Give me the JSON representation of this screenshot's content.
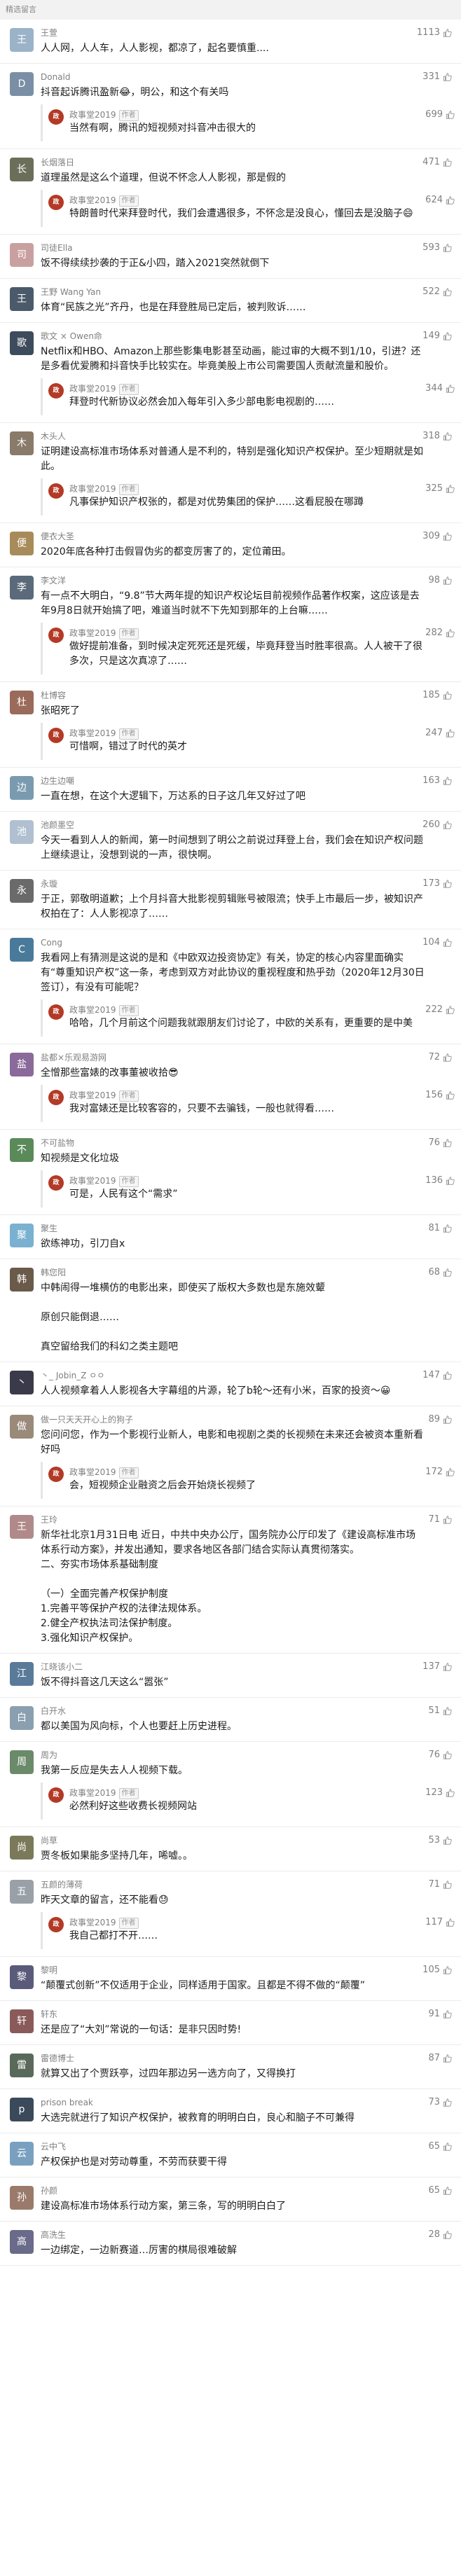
{
  "section_title": "精选留言",
  "author_name": "政事堂2019",
  "author_tag": "作者",
  "comments": [
    {
      "name": "王萱",
      "avatar_color": "#9bb3c9",
      "likes": "1113",
      "content": "人人网，人人车，人人影视，都凉了，起名要慎重....",
      "reply": null
    },
    {
      "name": "Donald",
      "avatar_color": "#7a8fa6",
      "likes": "331",
      "content": "抖音起诉腾讯盈新😂，明公，和这个有关吗",
      "reply": {
        "likes": "699",
        "content": "当然有啊，腾讯的短视频对抖音冲击很大的"
      }
    },
    {
      "name": "长烟落日",
      "avatar_color": "#6b6f5a",
      "likes": "471",
      "content": "道理虽然是这么个道理，但说不怀念人人影视，那是假的",
      "reply": {
        "likes": "624",
        "content": "特朗普时代来拜登时代，我们会遭遇很多，不怀念是没良心，懂回去是没脑子😄"
      }
    },
    {
      "name": "司徒Ella",
      "avatar_color": "#c9a0a0",
      "likes": "593",
      "content": "饭不得续续抄袭的于正&小四，踏入2021突然就倒下",
      "reply": null
    },
    {
      "name": "王野 Wang Yan",
      "avatar_color": "#4a5a6a",
      "likes": "522",
      "content": "体育“民族之光”齐丹，也是在拜登胜局已定后，被判败诉……",
      "reply": null
    },
    {
      "name": "歌文 × Owen命",
      "avatar_color": "#3d4b5c",
      "likes": "149",
      "content": "Netflix和HBO、Amazon上那些影集电影甚至动画，能过审的大概不到1/10，引进？还是多看优爱腾和抖音快手比较实在。毕竟美股上市公司需要国人贡献流量和股价。",
      "reply": {
        "likes": "344",
        "content": "拜登时代新协议必然会加入每年引入多少部电影电视剧的……"
      }
    },
    {
      "name": "木头人",
      "avatar_color": "#8a7a6a",
      "likes": "318",
      "content": "证明建设高标准市场体系对普通人是不利的，特别是强化知识产权保护。至少短期就是如此。",
      "reply": {
        "likes": "325",
        "content": "凡事保护知识产权张的，都是对优势集团的保护……这看屁股在哪蹲"
      }
    },
    {
      "name": "便衣大圣",
      "avatar_color": "#a88b5a",
      "likes": "309",
      "content": "2020年底各种打击假冒伪劣的都变厉害了的，定位莆田。",
      "reply": null
    },
    {
      "name": "李文洋",
      "avatar_color": "#5a6a7a",
      "likes": "98",
      "content": "有一点不大明白，“9.8”节大两年提的知识产权论坛目前视频作品著作权案，这应该是去年9月8日就开始搞了吧，难道当时就不下先知到那年的上台嘛……",
      "reply": {
        "likes": "282",
        "content": "做好提前准备，到时候决定死死还是死缓，毕竟拜登当时胜率很高。人人被干了很多次，只是这次真凉了……"
      }
    },
    {
      "name": "杜博容",
      "avatar_color": "#9a6a5a",
      "likes": "185",
      "content": "张昭死了",
      "reply": {
        "likes": "247",
        "content": "可惜啊，错过了时代的英才"
      }
    },
    {
      "name": "边生边嘲",
      "avatar_color": "#7a9ab0",
      "likes": "163",
      "content": "一直在想，在这个大逻辑下，万达系的日子这几年又好过了吧",
      "reply": null
    },
    {
      "name": "池颜墨空",
      "avatar_color": "#b0c0d0",
      "likes": "260",
      "content": "今天一看到人人的新闻，第一时间想到了明公之前说过拜登上台，我们会在知识产权问题上继续退让，没想到说的一声，很快啊。",
      "reply": null
    },
    {
      "name": "永璇",
      "avatar_color": "#6a6a6a",
      "likes": "173",
      "content": "于正，郭敬明道歉；上个月抖音大批影视剪辑账号被限流；快手上市最后一步，被知识产权拍在了：人人影视凉了……",
      "reply": null
    },
    {
      "name": "Cong",
      "avatar_color": "#4a7a9a",
      "likes": "104",
      "content": "我看网上有猜测是这说的是和《中欧双边投资协定》有关，协定的核心内容里面确实有“尊重知识产权”这一条，考虑到双方对此协议的重视程度和热乎劲（2020年12月30日签订），有没有可能呢？",
      "reply": {
        "likes": "222",
        "content": "哈哈，几个月前这个问题我就跟朋友们讨论了，中欧的关系有，更重要的是中美"
      }
    },
    {
      "name": "盐都×乐观易游网",
      "avatar_color": "#8a6a9a",
      "likes": "72",
      "content": "全憎那些富婊的改事董被收拾😎",
      "reply": {
        "likes": "156",
        "content": "我对富婊还是比较客容的，只要不去骗钱，一般也就得看……"
      }
    },
    {
      "name": "不可盐物",
      "avatar_color": "#5a8a5a",
      "likes": "76",
      "content": "知视频是文化垃圾",
      "reply": {
        "likes": "136",
        "content": "可是，人民有这个“需求”"
      }
    },
    {
      "name": "聚生",
      "avatar_color": "#7ab0d0",
      "likes": "81",
      "content": "欲练神功，引刀自x",
      "reply": null
    },
    {
      "name": "韩您阳",
      "avatar_color": "#6a5a4a",
      "likes": "68",
      "content": "中韩闹得一堆横仿的电影出来，即使买了版权大多数也是东施效颦\n\n原创只能倒退……\n\n真空留给我们的科幻之类主题吧",
      "reply": null
    },
    {
      "name": "丶_ Jobin_Z ㅇㅇ",
      "avatar_color": "#3a3a4a",
      "likes": "147",
      "content": "人人视频拿着人人影视各大字幕组的片源，轮了b轮～还有小米，百家的投资～😀",
      "reply": null
    },
    {
      "name": "做一只天天开心上的狗子",
      "avatar_color": "#9a8a7a",
      "likes": "89",
      "content": "您问问您，作为一个影视行业新人，电影和电视剧之类的长视频在未来还会被资本重新看好吗",
      "reply": {
        "likes": "172",
        "content": "会，短视频企业融资之后会开始烧长视频了"
      }
    },
    {
      "name": "王玲",
      "avatar_color": "#b08a8a",
      "likes": "71",
      "content": "新华社北京1月31日电 近日，中共中央办公厅，国务院办公厅印发了《建设高标准市场体系行动方案》，并发出通知，要求各地区各部门结合实际认真贯彻落实。\n二、夯实市场体系基础制度\n\n（一）全面完善产权保护制度\n1.完善平等保护产权的法律法规体系。\n2.健全产权执法司法保护制度。\n3.强化知识产权保护。",
      "reply": null
    },
    {
      "name": "江晓该小二",
      "avatar_color": "#5a7a9a",
      "likes": "137",
      "content": "饭不得抖音这几天这么“嚣张”",
      "reply": null
    },
    {
      "name": "白开水",
      "avatar_color": "#8aa0b0",
      "likes": "51",
      "content": "都以美国为风向标，个人也要赶上历史进程。",
      "reply": null
    },
    {
      "name": "周为",
      "avatar_color": "#6a8a6a",
      "likes": "76",
      "content": "我第一反应是失去人人视频下载。",
      "reply": {
        "likes": "123",
        "content": "必然利好这些收费长视频网站"
      }
    },
    {
      "name": "尚草",
      "avatar_color": "#7a7a5a",
      "likes": "53",
      "content": "贾冬板如果能多坚持几年，唏嘘。。",
      "reply": null
    },
    {
      "name": "五颜的薄荷",
      "avatar_color": "#9aa0a8",
      "likes": "71",
      "content": "昨天文章的留言，还不能看😓",
      "reply": {
        "likes": "117",
        "content": "我自己都打不开……"
      }
    },
    {
      "name": "黎明",
      "avatar_color": "#5a5a7a",
      "likes": "105",
      "content": "“颠覆式创新”不仅适用于企业，同样适用于国家。且都是不得不做的“颠覆”",
      "reply": null
    },
    {
      "name": "轩东",
      "avatar_color": "#8a5a5a",
      "likes": "91",
      "content": "还是应了“大刘”常说的一句话：是非只因时势!",
      "reply": null
    },
    {
      "name": "雷德博士",
      "avatar_color": "#5a6a5a",
      "likes": "87",
      "content": "就算又出了个贾跃亭，过四年那边另一选方向了，又得换打",
      "reply": null
    },
    {
      "name": "prison break",
      "avatar_color": "#3a4a5a",
      "likes": "73",
      "content": "大选完就进行了知识产权保护，被救育的明明白白，良心和脑子不可兼得",
      "reply": null
    },
    {
      "name": "云中飞",
      "avatar_color": "#7aa0c0",
      "likes": "65",
      "content": "产权保护也是对劳动尊重，不劳而获要干得",
      "reply": null
    },
    {
      "name": "孙颜",
      "avatar_color": "#9a7a6a",
      "likes": "65",
      "content": "建设高标准市场体系行动方案，第三条，写的明明白白了",
      "reply": null
    },
    {
      "name": "高洗生",
      "avatar_color": "#6a6a8a",
      "likes": "28",
      "content": "一边绑定，一边新赛道…厉害的棋局很难破解",
      "reply": null
    }
  ]
}
